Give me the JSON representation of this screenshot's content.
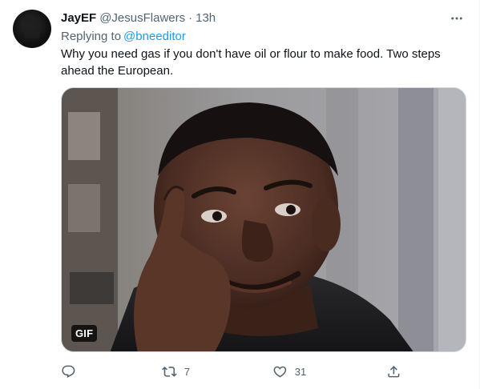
{
  "tweet": {
    "author_name": "JayEF",
    "author_handle": "@JesusFlawers",
    "separator": "·",
    "timestamp": "13h",
    "reply_prefix": "Replying to",
    "reply_to": "@bneeditor",
    "text": "Why you need gas if you don't have oil or flour to make food. Two steps ahead the European.",
    "media": {
      "badge": "GIF"
    },
    "actions": {
      "reply_count": "",
      "retweet_count": "7",
      "like_count": "31"
    }
  },
  "colors": {
    "link": "#1d9bf0",
    "secondary_text": "#536471",
    "primary_text": "#0f1419"
  },
  "icons": [
    "more-icon",
    "reply-icon",
    "retweet-icon",
    "like-icon",
    "share-icon"
  ]
}
